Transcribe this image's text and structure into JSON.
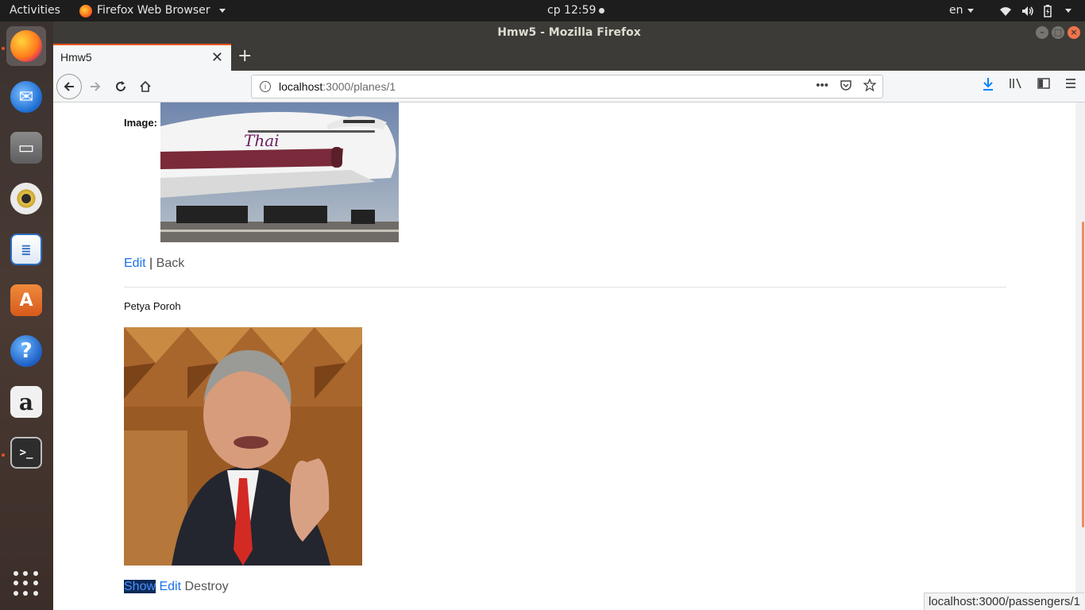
{
  "topbar": {
    "activities": "Activities",
    "app_name": "Firefox Web Browser",
    "clock": "ср 12:59",
    "language": "en"
  },
  "window": {
    "title": "Hmw5 - Mozilla Firefox"
  },
  "tabs": [
    {
      "label": "Hmw5"
    }
  ],
  "navbar": {
    "url_host": "localhost",
    "url_rest": ":3000/planes/1"
  },
  "page": {
    "image_label": "Image:",
    "edit": "Edit",
    "separator": "|",
    "back": "Back",
    "passenger_name": "Petya Poroh",
    "show": "Show",
    "passenger_edit": "Edit",
    "destroy": "Destroy"
  },
  "status_url": "localhost:3000/passengers/1",
  "colors": {
    "accent": "#e95420",
    "link": "#1a73e8"
  }
}
